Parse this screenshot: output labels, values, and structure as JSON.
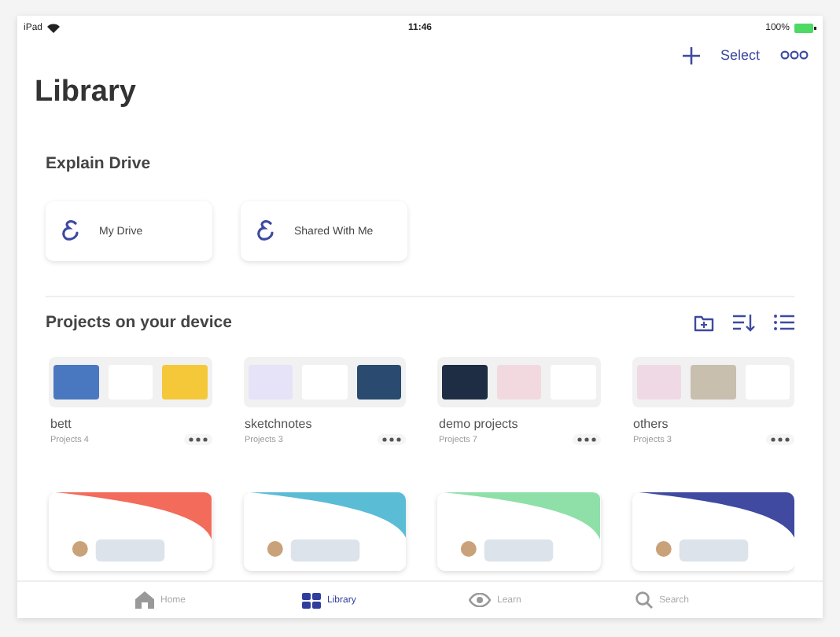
{
  "status_bar": {
    "device": "iPad",
    "time": "11:46",
    "battery": "100%"
  },
  "nav": {
    "select": "Select"
  },
  "title": "Library",
  "drive": {
    "title": "Explain Drive",
    "items": [
      {
        "label": "My Drive"
      },
      {
        "label": "Shared With Me"
      }
    ]
  },
  "projects": {
    "title": "Projects on your device",
    "folders": [
      {
        "name": "bett",
        "count": "Projects 4"
      },
      {
        "name": "sketchnotes",
        "count": "Projects 3"
      },
      {
        "name": "demo projects",
        "count": "Projects 7"
      },
      {
        "name": "others",
        "count": "Projects 3"
      }
    ]
  },
  "featured": [
    {
      "color": "#f26b5b"
    },
    {
      "color": "#5bbcd6"
    },
    {
      "color": "#8ee0a8"
    },
    {
      "color": "#3f4aa0"
    }
  ],
  "tabs": [
    {
      "label": "Home",
      "selected": false
    },
    {
      "label": "Library",
      "selected": true
    },
    {
      "label": "Learn",
      "selected": false
    },
    {
      "label": "Search",
      "selected": false
    }
  ]
}
